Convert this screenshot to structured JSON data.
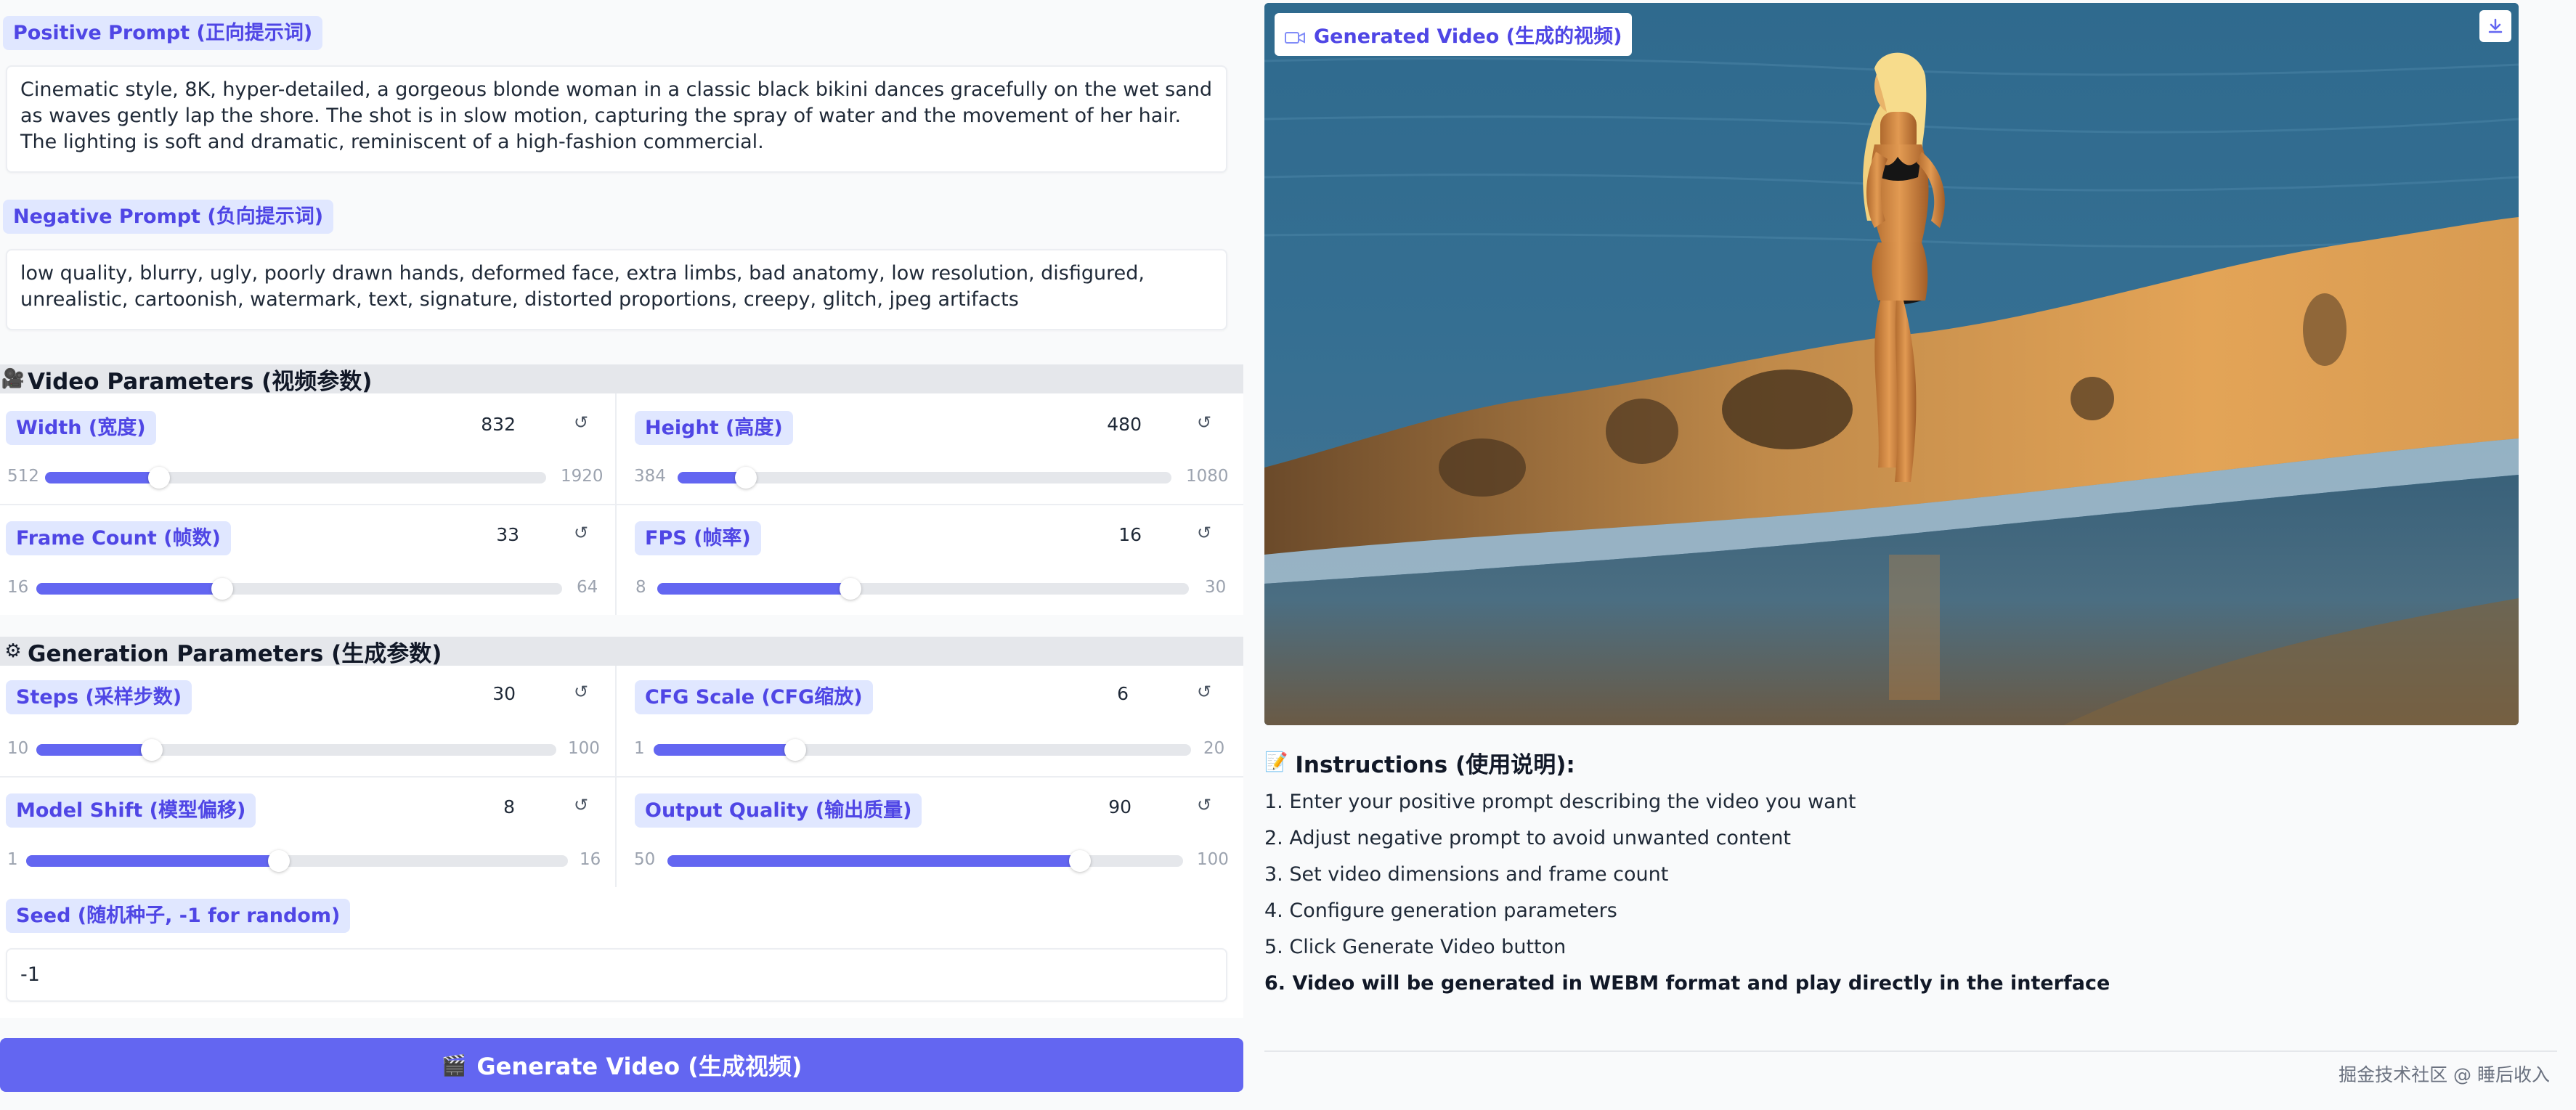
{
  "positive_prompt": {
    "label": "Positive Prompt (正向提示词)",
    "value": "Cinematic style, 8K, hyper-detailed, a gorgeous blonde woman in a classic black bikini dances gracefully on the wet sand as waves gently lap the shore. The shot is in slow motion, capturing the spray of water and the movement of her hair. The lighting is soft and dramatic, reminiscent of a high-fashion commercial."
  },
  "negative_prompt": {
    "label": "Negative Prompt (负向提示词)",
    "value": "low quality, blurry, ugly, poorly drawn hands, deformed face, extra limbs, bad anatomy, low resolution, disfigured, unrealistic, cartoonish, watermark, text, signature, distorted proportions, creepy, glitch, jpeg artifacts"
  },
  "video_params": {
    "title": "Video Parameters (视频参数)",
    "icon": "film-projector-icon",
    "sliders": [
      {
        "label": "Width (宽度)",
        "value": "832",
        "min": "512",
        "max": "1920",
        "fraction": 0.227
      },
      {
        "label": "Height (高度)",
        "value": "480",
        "min": "384",
        "max": "1080",
        "fraction": 0.138
      },
      {
        "label": "Frame Count (帧数)",
        "value": "33",
        "min": "16",
        "max": "64",
        "fraction": 0.354
      },
      {
        "label": "FPS (帧率)",
        "value": "16",
        "min": "8",
        "max": "30",
        "fraction": 0.364
      }
    ]
  },
  "generation_params": {
    "title": "Generation Parameters (生成参数)",
    "icon": "gear-icon",
    "sliders": [
      {
        "label": "Steps (采样步数)",
        "value": "30",
        "min": "10",
        "max": "100",
        "fraction": 0.222
      },
      {
        "label": "CFG Scale (CFG缩放)",
        "value": "6",
        "min": "1",
        "max": "20",
        "fraction": 0.263
      },
      {
        "label": "Model Shift (模型偏移)",
        "value": "8",
        "min": "1",
        "max": "16",
        "fraction": 0.467
      },
      {
        "label": "Output Quality (输出质量)",
        "value": "90",
        "min": "50",
        "max": "100",
        "fraction": 0.8
      }
    ]
  },
  "seed": {
    "label": "Seed (随机种子, -1 for random)",
    "value": "-1"
  },
  "generate_button": {
    "label": "Generate Video (生成视频)",
    "icon": "clapper-board-icon"
  },
  "video_output": {
    "label": "Generated Video (生成的视频)",
    "icon": "video-camera-icon",
    "download_icon": "download-icon"
  },
  "instructions": {
    "title": "Instructions (使用说明):",
    "icon": "memo-icon",
    "items": [
      "1. Enter your positive prompt describing the video you want",
      "2. Adjust negative prompt to avoid unwanted content",
      "3. Set video dimensions and frame count",
      "4. Configure generation parameters",
      "5. Click Generate Video button",
      "6. Video will be generated in WEBM format and play directly in the interface"
    ]
  },
  "footer": {
    "credit": "掘金技术社区 @ 睡后收入"
  },
  "colors": {
    "accent": "#6366f1",
    "chip_bg": "#e0e7ff",
    "chip_text": "#4f46e5",
    "section_bg": "#e5e7eb"
  }
}
